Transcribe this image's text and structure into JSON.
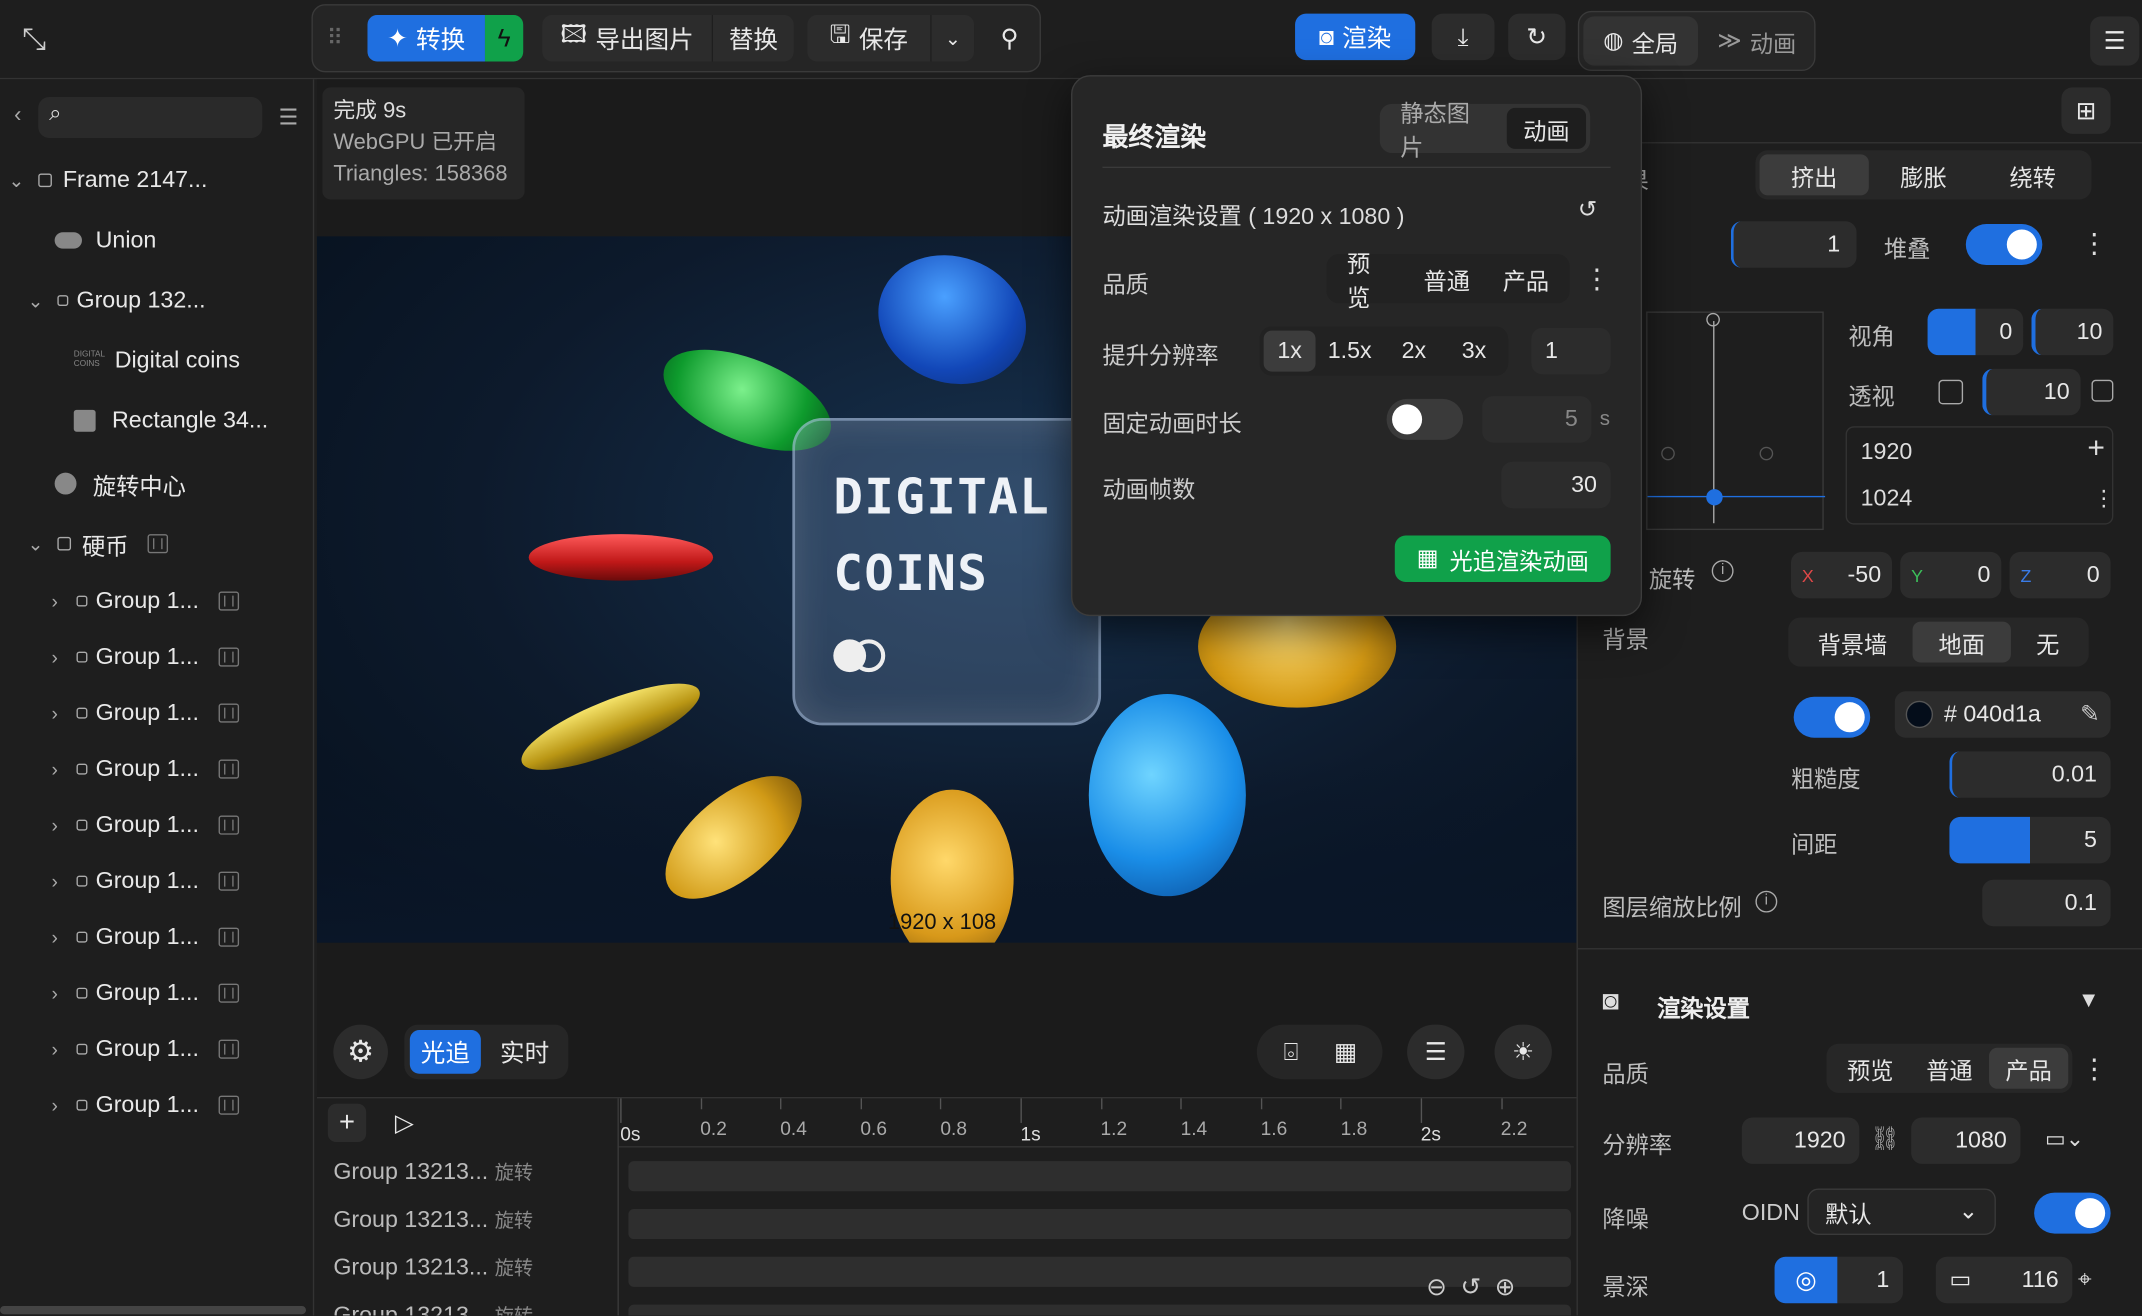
{
  "toolbar": {
    "convert": "转换",
    "export": "导出图片",
    "replace": "替换",
    "save": "保存",
    "render": "渲染",
    "global": "全局",
    "animation": "动画"
  },
  "sidebar": {
    "search_placeholder": "",
    "items": [
      {
        "label": "Frame 2147...",
        "level": 0,
        "kind": "frame",
        "expanded": true
      },
      {
        "label": "Union",
        "level": 1,
        "kind": "union"
      },
      {
        "label": "Group 132...",
        "level": 1,
        "kind": "group",
        "expanded": true
      },
      {
        "label": "Digital coins",
        "level": 2,
        "kind": "image"
      },
      {
        "label": "Rectangle 34...",
        "level": 2,
        "kind": "rect"
      },
      {
        "label": "旋转中心",
        "level": 1,
        "kind": "pivot"
      },
      {
        "label": "硬币",
        "level": 1,
        "kind": "frame",
        "expanded": true
      },
      {
        "label": "Group 1...",
        "level": 2,
        "kind": "group"
      },
      {
        "label": "Group 1...",
        "level": 2,
        "kind": "group"
      },
      {
        "label": "Group 1...",
        "level": 2,
        "kind": "group"
      },
      {
        "label": "Group 1...",
        "level": 2,
        "kind": "group"
      },
      {
        "label": "Group 1...",
        "level": 2,
        "kind": "group"
      },
      {
        "label": "Group 1...",
        "level": 2,
        "kind": "group"
      },
      {
        "label": "Group 1...",
        "level": 2,
        "kind": "group"
      },
      {
        "label": "Group 1...",
        "level": 2,
        "kind": "group"
      },
      {
        "label": "Group 1...",
        "level": 2,
        "kind": "group"
      },
      {
        "label": "Group 1...",
        "level": 2,
        "kind": "group"
      }
    ]
  },
  "stats": {
    "line1": "完成 9s",
    "line2": "WebGPU 已开启",
    "line3": "Triangles: 158368"
  },
  "scene": {
    "title1": "DIGITAL",
    "title2": "COINS",
    "size_label": "1920 x 108"
  },
  "viewport_modes": {
    "raytrace": "光追",
    "realtime": "实时"
  },
  "timeline": {
    "ticks": [
      "0s",
      "0.2",
      "0.4",
      "0.6",
      "0.8",
      "1s",
      "1.2",
      "1.4",
      "1.6",
      "1.8",
      "2s",
      "2.2"
    ],
    "tracks": [
      {
        "name": "Group 13213...",
        "type": "旋转"
      },
      {
        "name": "Group 13213...",
        "type": "旋转"
      },
      {
        "name": "Group 13213...",
        "type": "旋转"
      },
      {
        "name": "Group 13213...",
        "type": "旋转"
      }
    ]
  },
  "popup": {
    "title": "最终渲染",
    "tab_static": "静态图片",
    "tab_anim": "动画",
    "settings_label": "动画渲染设置 ( 1920 x 1080 )",
    "quality_label": "品质",
    "quality_opts": [
      "预览",
      "普通",
      "产品"
    ],
    "upscale_label": "提升分辨率",
    "upscale_opts": [
      "1x",
      "1.5x",
      "2x",
      "3x"
    ],
    "upscale_value": "1",
    "fixed_duration_label": "固定动画时长",
    "duration_value": "5",
    "duration_unit": "s",
    "fps_label": "动画帧数",
    "fps_value": "30",
    "action": "光追渲染动画"
  },
  "props": {
    "effect_label": "效果",
    "effect_opts": [
      "挤出",
      "膨胀",
      "绕转"
    ],
    "depth_value": "1",
    "stack_label": "堆叠",
    "fov_label": "视角",
    "fov_value": "0",
    "fov_value2": "10",
    "persp_label": "透视",
    "persp_value": "10",
    "width": "1920",
    "height": "1024",
    "rotation_label": "旋转",
    "rot_x": "-50",
    "rot_y": "0",
    "rot_z": "0",
    "bg_label": "背景",
    "bg_opts": [
      "背景墙",
      "地面",
      "无"
    ],
    "bg_color": "# 040d1a",
    "roughness_label": "粗糙度",
    "roughness_value": "0.01",
    "spacing_label": "间距",
    "spacing_value": "5",
    "layer_scale_label": "图层缩放比例",
    "layer_scale_value": "0.1"
  },
  "render_settings": {
    "title": "渲染设置",
    "quality_label": "品质",
    "quality_opts": [
      "预览",
      "普通",
      "产品"
    ],
    "res_label": "分辨率",
    "res_w": "1920",
    "res_h": "1080",
    "denoise_label": "降噪",
    "denoise_engine": "OIDN",
    "denoise_mode": "默认",
    "dof_label": "景深",
    "dof_value": "1",
    "dof_value2": "116"
  },
  "colors": {
    "accent": "#1f6fe0",
    "green": "#10a14a",
    "bg_color": "#040d1a"
  }
}
